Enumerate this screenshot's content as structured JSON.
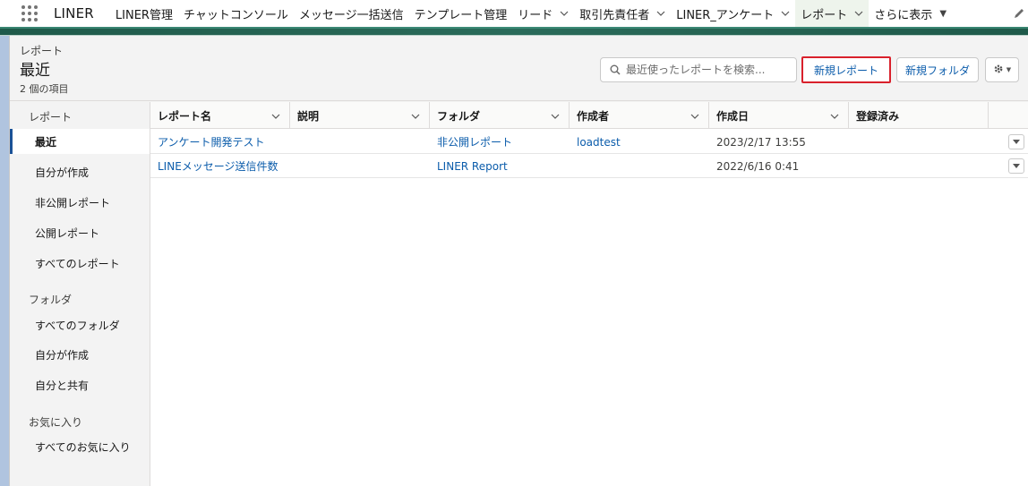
{
  "app": {
    "name": "LINER"
  },
  "nav": {
    "items": [
      {
        "label": "LINER管理"
      },
      {
        "label": "チャットコンソール"
      },
      {
        "label": "メッセージ一括送信"
      },
      {
        "label": "テンプレート管理"
      },
      {
        "label": "リード"
      },
      {
        "label": "取引先責任者"
      },
      {
        "label": "LINER_アンケート"
      },
      {
        "label": "レポート"
      },
      {
        "label": "さらに表示"
      }
    ]
  },
  "header": {
    "breadcrumb": "レポート",
    "title": "最近",
    "item_count": "2 個の項目",
    "search_placeholder": "最近使ったレポートを検索...",
    "new_report_label": "新規レポート",
    "new_folder_label": "新規フォルダ"
  },
  "sidebar": {
    "reports_heading": "レポート",
    "report_items": [
      {
        "label": "最近"
      },
      {
        "label": "自分が作成"
      },
      {
        "label": "非公開レポート"
      },
      {
        "label": "公開レポート"
      },
      {
        "label": "すべてのレポート"
      }
    ],
    "folders_heading": "フォルダ",
    "folder_items": [
      {
        "label": "すべてのフォルダ"
      },
      {
        "label": "自分が作成"
      },
      {
        "label": "自分と共有"
      }
    ],
    "favorites_heading": "お気に入り",
    "favorite_items": [
      {
        "label": "すべてのお気に入り"
      }
    ]
  },
  "table": {
    "columns": [
      {
        "label": "レポート名"
      },
      {
        "label": "説明"
      },
      {
        "label": "フォルダ"
      },
      {
        "label": "作成者"
      },
      {
        "label": "作成日"
      },
      {
        "label": "登録済み"
      }
    ],
    "rows": [
      {
        "name": "アンケート開発テスト",
        "description": "",
        "folder": "非公開レポート",
        "created_by": "loadtest",
        "created_date": "2023/2/17 13:55",
        "subscribed": ""
      },
      {
        "name": "LINEメッセージ送信件数",
        "description": "",
        "folder": "LINER Report",
        "created_by": "",
        "created_date": "2022/6/16 0:41",
        "subscribed": ""
      }
    ]
  },
  "colors": {
    "link": "#0b5cab",
    "highlight_border": "#d9212c",
    "active_marker": "#1b5297",
    "brand_bar": "#1f5a4a"
  }
}
